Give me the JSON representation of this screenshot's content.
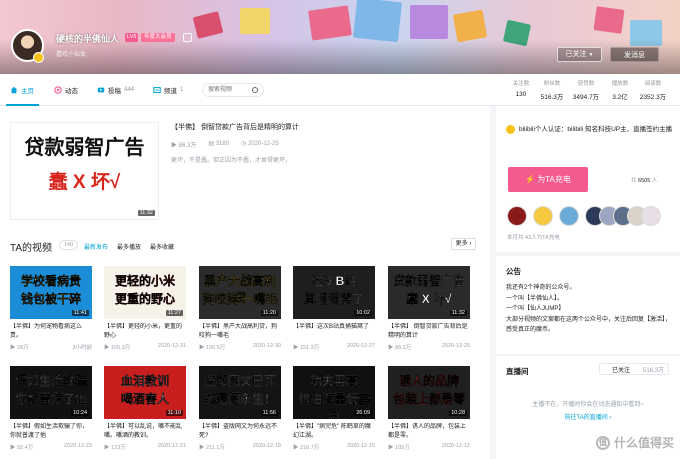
{
  "header": {
    "username": "硬核的半佛仙人",
    "level": "LV6",
    "vip": "年度大会员",
    "signature": "喜欢小仙女",
    "follow_label": "已关注",
    "message_label": "发消息"
  },
  "nav": {
    "tabs": [
      {
        "label": "主页",
        "count": ""
      },
      {
        "label": "动态",
        "count": ""
      },
      {
        "label": "投稿",
        "count": "444"
      },
      {
        "label": "频道",
        "count": "1"
      }
    ],
    "search_placeholder": "搜索视频"
  },
  "stats": [
    {
      "label": "关注数",
      "value": "130"
    },
    {
      "label": "粉丝数",
      "value": "516.3万"
    },
    {
      "label": "获赞数",
      "value": "3494.7万"
    },
    {
      "label": "播放数",
      "value": "3.2亿"
    },
    {
      "label": "阅读数",
      "value": "2352.3万"
    }
  ],
  "featured": {
    "thumb_line1": "贷款弱智广告",
    "thumb_line2": "蠢 X 坏√",
    "duration": "11:32",
    "title": "【半佛】 倒智贷款广告背后是精明的算计",
    "plays": "86.3万",
    "comments": "3180",
    "date": "2020-12-25",
    "desc": "更坏，不是蠢。但正因为不蠢，才显得更坏。"
  },
  "videos_section": {
    "title": "TA的视频",
    "count": "140",
    "sorts": [
      "最新发布",
      "最多播放",
      "最多收藏"
    ],
    "more_label": "更多"
  },
  "videos": [
    {
      "thumb": "学校看病贵\n钱包被干碎",
      "duration": "11:41",
      "title": "【半佛】为何宠物看病这么贵。",
      "plays": "28万",
      "date": "3小时前",
      "bg": "#1a8cd8",
      "fg": "#ffe24a"
    },
    {
      "thumb": "更轻的小米\n更重的野心",
      "duration": "11:27",
      "title": "【半佛】更轻的小米，更重的野心",
      "plays": "105.3万",
      "date": "2020-12-31",
      "bg": "#f7f2e8",
      "fg": "#d52a1e"
    },
    {
      "thumb": "黑产大战高利贷\n狗咬狗 一嘴毛",
      "duration": "11:20",
      "title": "【半佛】黑产大战高利贷，狗咬狗一嘴毛",
      "plays": "106.5万",
      "date": "2020-12-30",
      "bg": "#2b2b2b",
      "fg": "#ffe24a"
    },
    {
      "thumb": "这次B站\n真捅猫窝了",
      "duration": "10:02",
      "title": "【半佛】这次B站真捅猫窝了",
      "plays": "151.3万",
      "date": "2020-12-27",
      "bg": "#1e1e1e",
      "fg": "#ffffff"
    },
    {
      "thumb": "贷款弱智广告\n蠢 X 坏√",
      "duration": "11:32",
      "title": "【半佛】 倒智贷款广告背后是精明的算计",
      "plays": "86.3万",
      "date": "2020-12-25",
      "bg": "#2a2a2a",
      "fg": "#ffffff"
    },
    {
      "thumb": "假如生活欺骗了你\n你就普渡了他",
      "duration": "10:24",
      "title": "【半佛】假如生活欺骗了你，你就普渡了他",
      "plays": "92.4万",
      "date": "2020-12-23",
      "bg": "#111111",
      "fg": "#ffffff"
    },
    {
      "thumb": "血泪教训\n喝酒害人",
      "duration": "11:10",
      "title": "【半佛】可以乱说，嘴不能乱嘴。嘴酒的教训。",
      "plays": "123万",
      "date": "2020-12-21",
      "bg": "#c81e1e",
      "fg": "#ffffff"
    },
    {
      "thumb": "盗版网文已死\n笔趣阁永生！",
      "duration": "11:56",
      "title": "【半佛】盗版网文为何永远不死?",
      "plays": "211.1万",
      "date": "2020-12-18",
      "bg": "#141414",
      "fg": "#ffffff"
    },
    {
      "thumb": "功夫再高\n也怕海量低鹤草",
      "duration": "26:09",
      "title": "【半佛】\"病完危\" 陈鹤草的魔幻江湖。",
      "plays": "216.7万",
      "date": "2020-12-15",
      "bg": "#101010",
      "fg": "#ffffff"
    },
    {
      "thumb": "诱人的品牌\n包装上都是零",
      "duration": "10:28",
      "title": "【半佛】诱人的品牌，包装上都是零。",
      "plays": "105万",
      "date": "2020-12-12",
      "bg": "#202020",
      "fg": "#ff3a3a"
    }
  ],
  "sidebar": {
    "cert": "bilibili个人认证：bilibili 知名科技UP主、直播签约主播",
    "charge_label": "为TA充电",
    "charge_count_prefix": "共",
    "charge_count": "6505",
    "charge_count_suffix": "人",
    "fan_note": "本月共 43人为TA充电",
    "notice_title": "公告",
    "notice_lines": [
      "我还有2个神奇的公众号。",
      "一个叫【半佛仙人】。",
      "一个叫【仙人JUMP】",
      "大部分视频的文案都在这两个公众号中，关注后回复【激活】，感受真正的魔币。"
    ],
    "live_title": "直播间",
    "live_status": "已关注",
    "live_count": "516.3万",
    "live_empty": "主播不在，开播时你会在动态通知中看到~",
    "live_link": "前往TA的直播间 ›"
  },
  "watermark": "什么值得买",
  "colors": {
    "accent": "#00a1d6",
    "pink": "#f45a8d",
    "muted": "#99a2aa"
  }
}
